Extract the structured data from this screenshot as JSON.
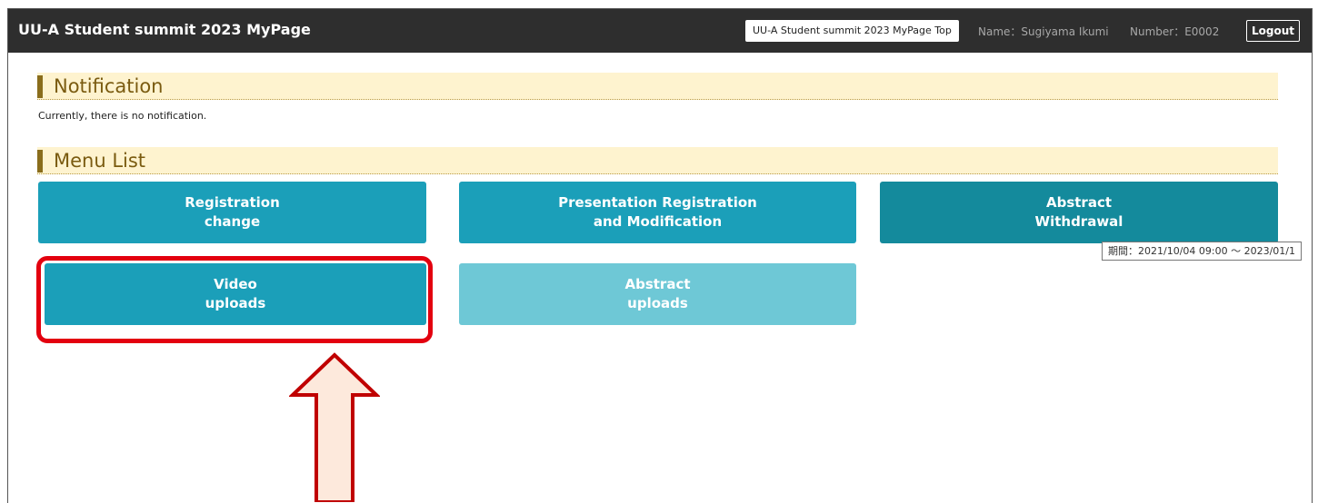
{
  "header": {
    "app_title": "UU-A Student summit 2023 MyPage",
    "top_link": "UU-A Student summit 2023 MyPage Top",
    "user_name": "Name：Sugiyama Ikumi",
    "user_number": "Number：E0002",
    "logout_label": "Logout"
  },
  "notification": {
    "heading": "Notification",
    "message": "Currently, there is no notification."
  },
  "menu": {
    "heading": "Menu List",
    "items": [
      {
        "line1": "Registration",
        "line2": "change",
        "state": "enabled",
        "color": "#1b9fb9"
      },
      {
        "line1": "Presentation Registration",
        "line2": "and Modification",
        "state": "enabled",
        "color": "#1b9fb9"
      },
      {
        "line1": "Abstract",
        "line2": "Withdrawal",
        "state": "enabled",
        "color": "#148a9c"
      },
      {
        "line1": "Video",
        "line2": "uploads",
        "state": "enabled",
        "color": "#1b9fb9"
      },
      {
        "line1": "Abstract",
        "line2": "uploads",
        "state": "disabled",
        "color": "#6ec8d6"
      }
    ]
  },
  "tooltip": {
    "text": "期間：2021/10/04 09:00 ～ 2023/01/1"
  },
  "annotation": {
    "highlight_color": "#e3000f",
    "arrow_fill": "#fde9dc",
    "arrow_stroke": "#c00000"
  }
}
